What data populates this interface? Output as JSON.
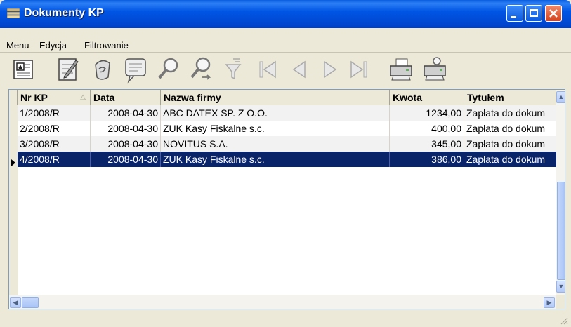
{
  "window": {
    "title": "Dokumenty KP",
    "title_icon": "documents-stack-icon",
    "buttons": [
      "minimize-icon",
      "maximize-icon",
      "close-icon"
    ],
    "colors": {
      "titlebar": "#0055E5",
      "close": "#D4431C",
      "selection": "#0A246A",
      "chrome": "#ECE9D8"
    }
  },
  "menu": {
    "items": [
      {
        "label": "Menu"
      },
      {
        "label": "Edycja"
      },
      {
        "label": "Filtrowanie"
      }
    ]
  },
  "toolbar": {
    "icons": [
      "add-document-icon",
      "edit-document-icon",
      "delete-document-icon",
      "view-document-icon",
      "search-icon",
      "search-next-icon",
      "filter-icon",
      "first-record-icon",
      "previous-record-icon",
      "next-record-icon",
      "last-record-icon",
      "print-icon",
      "print-preview-icon"
    ]
  },
  "grid": {
    "columns": [
      "Nr KP",
      "Data",
      "Nazwa firmy",
      "Kwota",
      "Tytułem"
    ],
    "sorted_column": "Nr KP",
    "rows": [
      {
        "nr": "1/2008/R",
        "data": "2008-04-30",
        "firma": "ABC DATEX SP. Z O.O.",
        "kwota": "1234,00",
        "tytul": "Zapłata do dokum"
      },
      {
        "nr": "2/2008/R",
        "data": "2008-04-30",
        "firma": "ZUK Kasy Fiskalne s.c.",
        "kwota": "400,00",
        "tytul": "Zapłata do dokum"
      },
      {
        "nr": "3/2008/R",
        "data": "2008-04-30",
        "firma": "NOVITUS S.A.",
        "kwota": "345,00",
        "tytul": "Zapłata do dokum"
      },
      {
        "nr": "4/2008/R",
        "data": "2008-04-30",
        "firma": "ZUK Kasy Fiskalne s.c.",
        "kwota": "386,00",
        "tytul": "Zapłata do dokum"
      }
    ],
    "selected_row": "4/2008/R"
  }
}
